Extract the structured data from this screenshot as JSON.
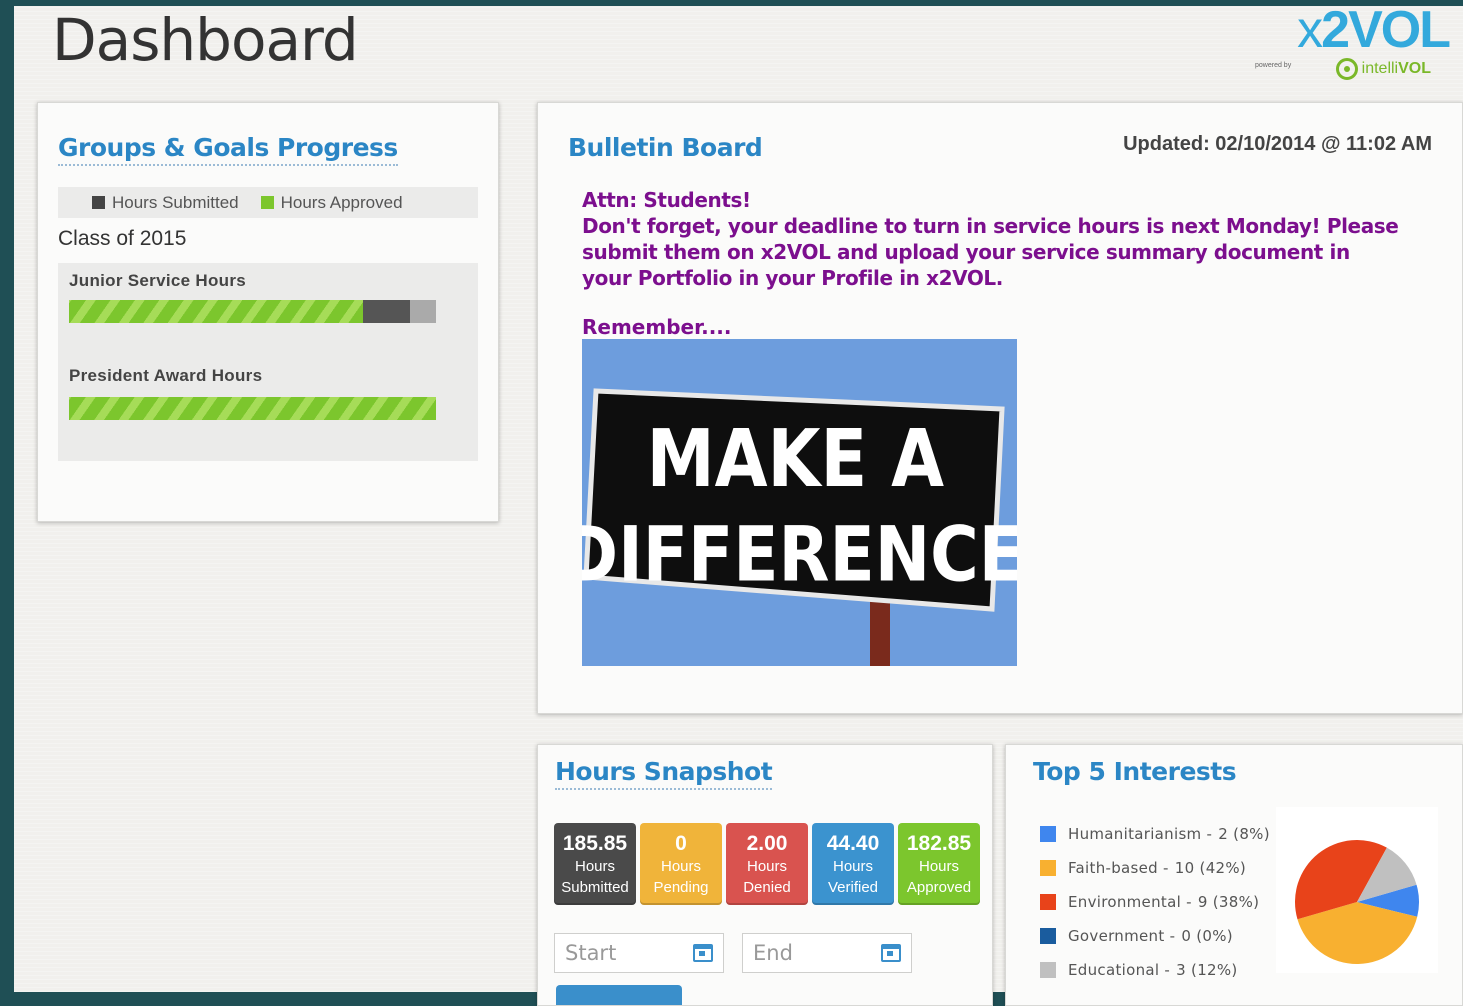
{
  "header": {
    "title": "Dashboard"
  },
  "logo": {
    "text_prefix": "x",
    "text_main": "2VOL",
    "powered_by": "powered by",
    "intelli": "intelli",
    "vol": "VOL"
  },
  "groups_goals": {
    "title": "Groups & Goals Progress",
    "legend": [
      {
        "label": "Hours Submitted",
        "color": "#444444"
      },
      {
        "label": "Hours Approved",
        "color": "#7cc62d"
      }
    ],
    "class_label": "Class of 2015",
    "goals": [
      {
        "label": "Junior Service Hours",
        "approved_fraction": 0.8,
        "submitted_fraction": 0.93
      },
      {
        "label": "President Award Hours",
        "approved_fraction": 1.0,
        "submitted_fraction": 1.0
      }
    ]
  },
  "bulletin": {
    "title": "Bulletin Board",
    "updated": "Updated: 02/10/2014 @ 11:02 AM",
    "lines": [
      "Attn: Students!",
      "Don't forget, your deadline to turn in service hours is next Monday! Please submit them on x2VOL and upload your service summary document in your Portfolio in your Profile in x2VOL."
    ],
    "remember": "Remember....",
    "image_sign_line1": "MAKE A",
    "image_sign_line2": "DIFFERENCE"
  },
  "hours_snapshot": {
    "title": "Hours Snapshot",
    "tiles": [
      {
        "value": "185.85",
        "label1": "Hours",
        "label2": "Submitted",
        "color": "#4a4a4a"
      },
      {
        "value": "0",
        "label1": "Hours",
        "label2": "Pending",
        "color": "#f0b43a"
      },
      {
        "value": "2.00",
        "label1": "Hours",
        "label2": "Denied",
        "color": "#d9534f"
      },
      {
        "value": "44.40",
        "label1": "Hours",
        "label2": "Verified",
        "color": "#3b93cf"
      },
      {
        "value": "182.85",
        "label1": "Hours",
        "label2": "Approved",
        "color": "#7cc62d"
      }
    ],
    "start_placeholder": "Start",
    "end_placeholder": "End"
  },
  "top_interests": {
    "title": "Top 5 Interests",
    "items": [
      {
        "name": "Humanitarianism -",
        "value": "2 (8%)",
        "count": 2,
        "color": "#3f86ee"
      },
      {
        "name": "Faith-based -",
        "value": "10 (42%)",
        "count": 10,
        "color": "#f8b030"
      },
      {
        "name": "Environmental -",
        "value": "9 (38%)",
        "count": 9,
        "color": "#e8431a"
      },
      {
        "name": "Government -",
        "value": "0 (0%)",
        "count": 0,
        "color": "#1a5c9e"
      },
      {
        "name": "Educational -",
        "value": "3 (12%)",
        "count": 3,
        "color": "#c0c0c0"
      }
    ]
  }
}
